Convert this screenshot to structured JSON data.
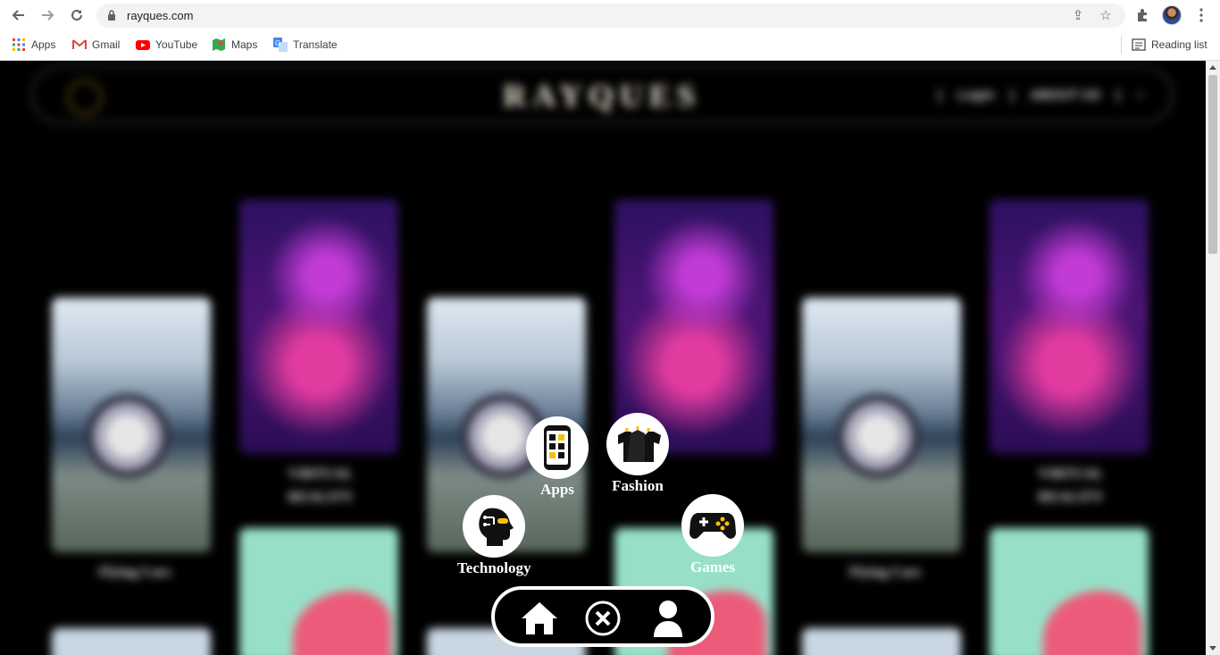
{
  "browser": {
    "url": "rayques.com",
    "bookmarks": [
      {
        "label": "Apps",
        "icon": "apps-grid-icon"
      },
      {
        "label": "Gmail",
        "icon": "gmail-icon"
      },
      {
        "label": "YouTube",
        "icon": "youtube-icon"
      },
      {
        "label": "Maps",
        "icon": "maps-icon"
      },
      {
        "label": "Translate",
        "icon": "translate-icon"
      }
    ],
    "reading_list": "Reading list"
  },
  "site": {
    "brand": "RAYQUES",
    "nav_login": "Login",
    "nav_about": "ABOUT US",
    "cards": {
      "vr_label_1": "VIRTUAL",
      "vr_label_2": "REALITY",
      "plane_label": "Flying Cars"
    }
  },
  "menu": {
    "apps": "Apps",
    "fashion": "Fashion",
    "technology": "Technology",
    "games": "Games"
  },
  "colors": {
    "page_bg": "#000000",
    "accent_yellow": "#f4c20d",
    "menu_circle": "#ffffff"
  }
}
